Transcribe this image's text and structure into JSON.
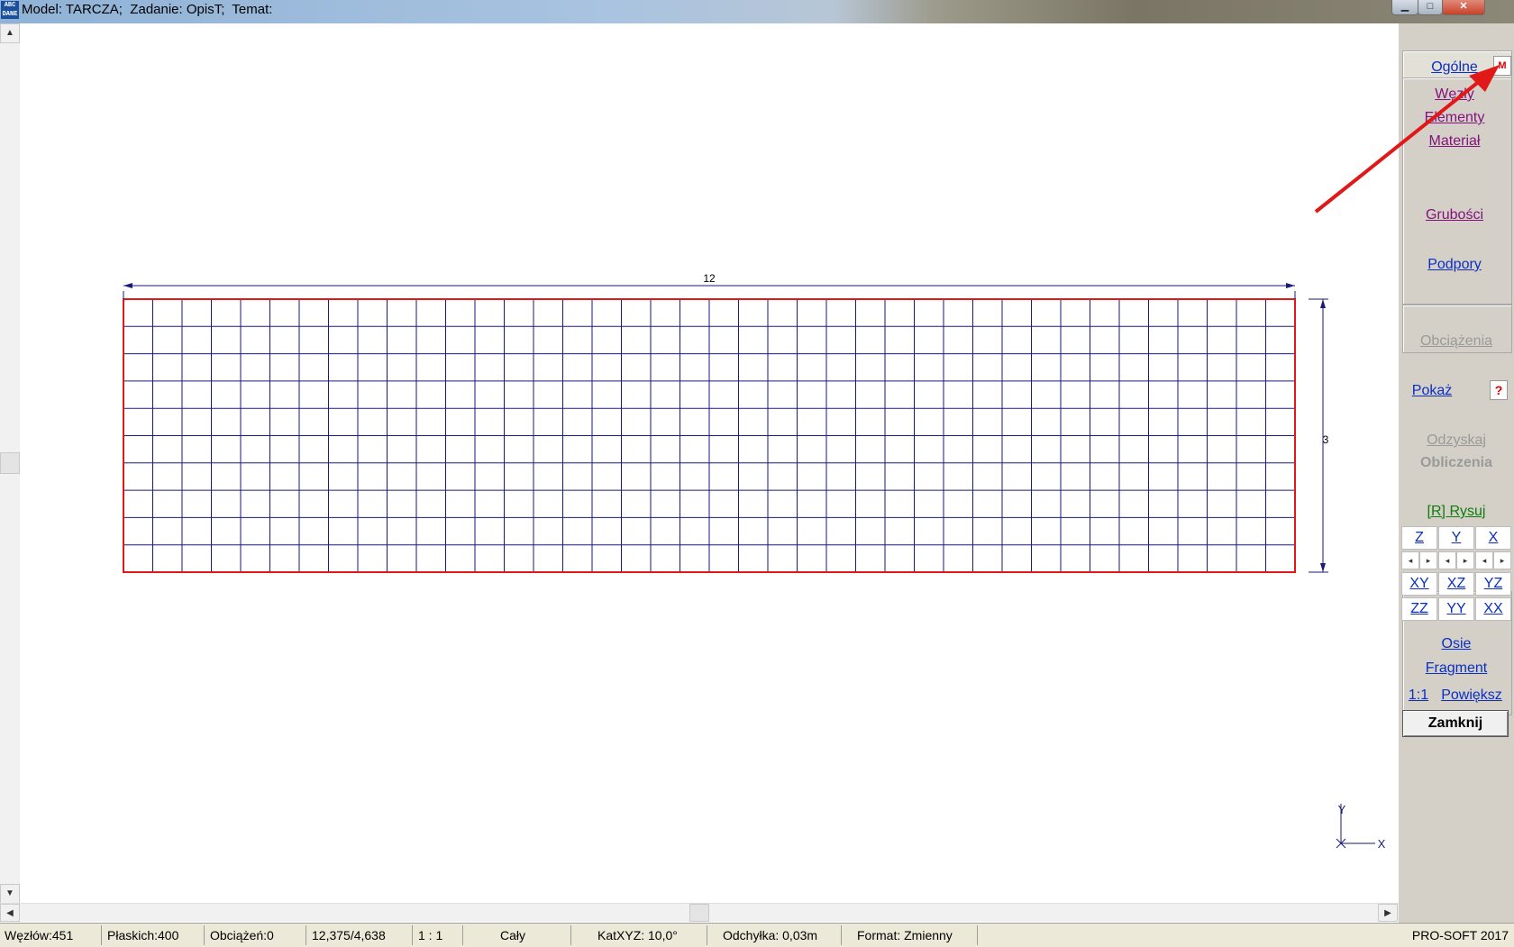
{
  "window": {
    "icon_text": "ABC DANE",
    "title": "Model: TARCZA;  Zadanie: OpisT;  Temat:",
    "min_icon": "minimize-icon",
    "max_icon": "maximize-icon",
    "close_icon": "close-icon",
    "min_glyph": "▁",
    "max_glyph": "□",
    "close_glyph": "✕"
  },
  "scroll": {
    "up_glyph": "▲",
    "down_glyph": "▼",
    "left_glyph": "◀",
    "right_glyph": "▶"
  },
  "drawing": {
    "dim_horizontal": "12",
    "dim_vertical": "3",
    "grid_columns": 40,
    "grid_rows": 10,
    "axis_x": "X",
    "axis_y": "Y",
    "colors": {
      "border": "#e01818",
      "grid": "#1a1a7a",
      "dimension": "#1a1a7a",
      "annotation_arrow": "#e01818"
    }
  },
  "panel": {
    "ogolne": "Ogólne",
    "m_badge": "M",
    "wezly": "Węzły",
    "elementy": "Elementy",
    "material": "Materiał",
    "grubosci": "Grubości",
    "podpory": "Podpory",
    "obciazenia": "Obciążenia",
    "pokaz": "Pokaż",
    "help": "?",
    "odzyskaj": "Odzyskaj",
    "obliczenia": "Obliczenia",
    "rysuj": "[R] Rysuj",
    "views": [
      "Z",
      "Y",
      "X",
      "XY",
      "XZ",
      "YZ",
      "ZZ",
      "YY",
      "XX"
    ],
    "arrow_left": "◂",
    "arrow_right": "▸",
    "osie": "Osie",
    "fragment": "Fragment",
    "one_to_one": "1:1",
    "powieksz": "Powiększ",
    "zamknij": "Zamknij"
  },
  "status": {
    "wezlow": "Węzłów:451",
    "plaskich": "Płaskich:400",
    "obciazen": "Obciążeń:0",
    "coords": "12,375/4,638",
    "scale": "1 : 1",
    "view": "Cały",
    "kat": "KatXYZ: 10,0°",
    "odchylka": "Odchyłka: 0,03m",
    "format": "Format: Zmienny",
    "company": "PRO-SOFT 2017"
  }
}
